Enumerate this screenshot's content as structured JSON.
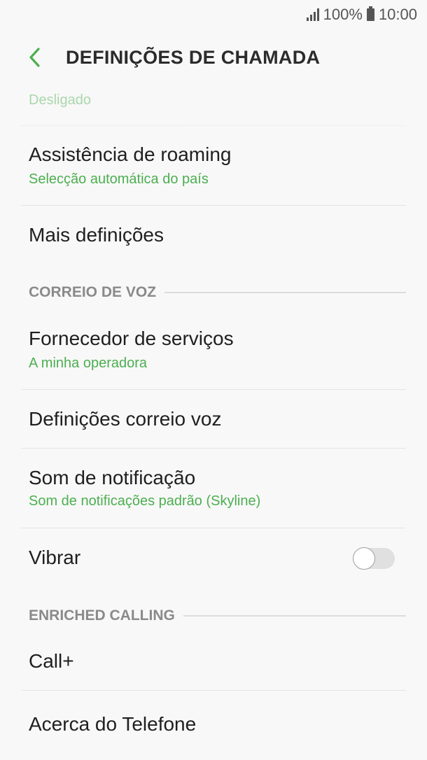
{
  "status_bar": {
    "battery": "100%",
    "time": "10:00",
    "signal_icon": "signal-icon",
    "battery_icon": "battery-icon"
  },
  "header": {
    "title": "DEFINIÇÕES DE CHAMADA",
    "back_icon": "chevron-left-icon",
    "accent": "#4caf50"
  },
  "items": {
    "partial": {
      "secondary": "Desligado"
    },
    "roaming": {
      "primary": "Assistência de roaming",
      "secondary": "Selecção automática do país"
    },
    "more": {
      "primary": "Mais definições"
    },
    "provider": {
      "primary": "Fornecedor de serviços",
      "secondary": "A minha operadora"
    },
    "voicemail_settings": {
      "primary": "Definições correio voz"
    },
    "notification_sound": {
      "primary": "Som de notificação",
      "secondary": "Som de notificações padrão (Skyline)"
    },
    "vibrate": {
      "primary": "Vibrar",
      "toggle_on": false
    },
    "call_plus": {
      "primary": "Call+"
    },
    "about": {
      "primary": "Acerca do Telefone"
    }
  },
  "sections": {
    "voicemail": "CORREIO DE VOZ",
    "enriched": "ENRICHED CALLING"
  }
}
